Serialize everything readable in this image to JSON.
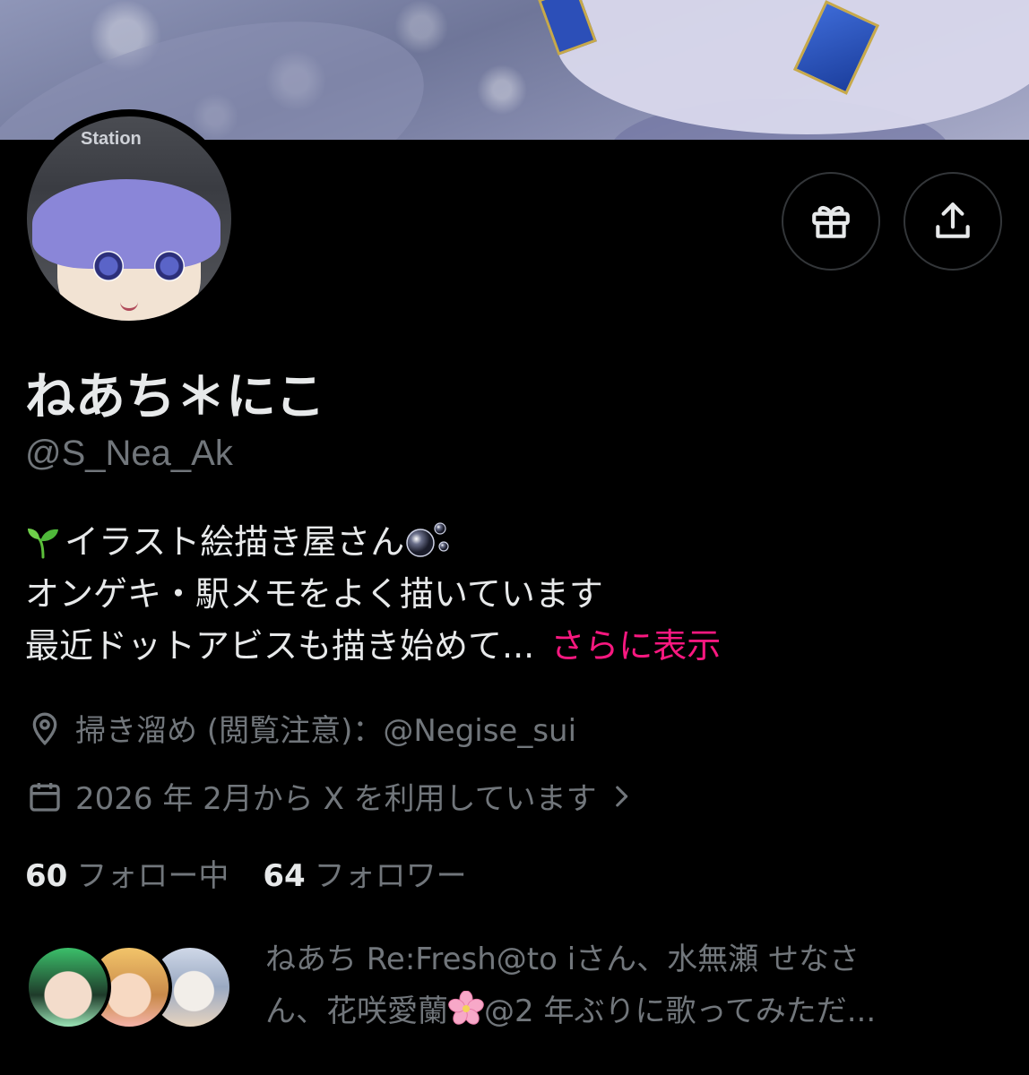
{
  "profile": {
    "display_name": "ねあち＊にこ",
    "handle": "@S_Nea_Ak",
    "avatar_sign_text": "Station",
    "bio": {
      "line1": "イラスト絵描き屋さん",
      "line2": "オンゲキ・駅メモをよく描いています",
      "line3": "最近ドットアビスも描き始めて...",
      "more_label": "さらに表示"
    },
    "location": "掃き溜め (閲覧注意)：@Negise_sui",
    "joined": "2026 年 2月から X を利用しています",
    "following_count": "60",
    "following_label": "フォロー中",
    "followers_count": "64",
    "followers_label": "フォロワー"
  },
  "followed_by": {
    "line1": "ねあち Re:Fresh@to iさん、水無瀬 せなさ",
    "line2_pre": "ん、花咲愛蘭",
    "line2_post": "@2 年ぶりに歌ってみただ..."
  },
  "icons": {
    "gift": "gift-icon",
    "share": "share-icon",
    "location": "location-pin-icon",
    "calendar": "calendar-icon",
    "chevron": "chevron-right-icon",
    "sprout": "seedling-emoji",
    "bubbles": "bubbles-emoji",
    "sakura": "cherry-blossom-emoji"
  },
  "colors": {
    "background": "#000000",
    "primary_text": "#e7e9ea",
    "secondary_text": "#71767b",
    "accent_link": "#f91880",
    "button_border": "#333639"
  }
}
